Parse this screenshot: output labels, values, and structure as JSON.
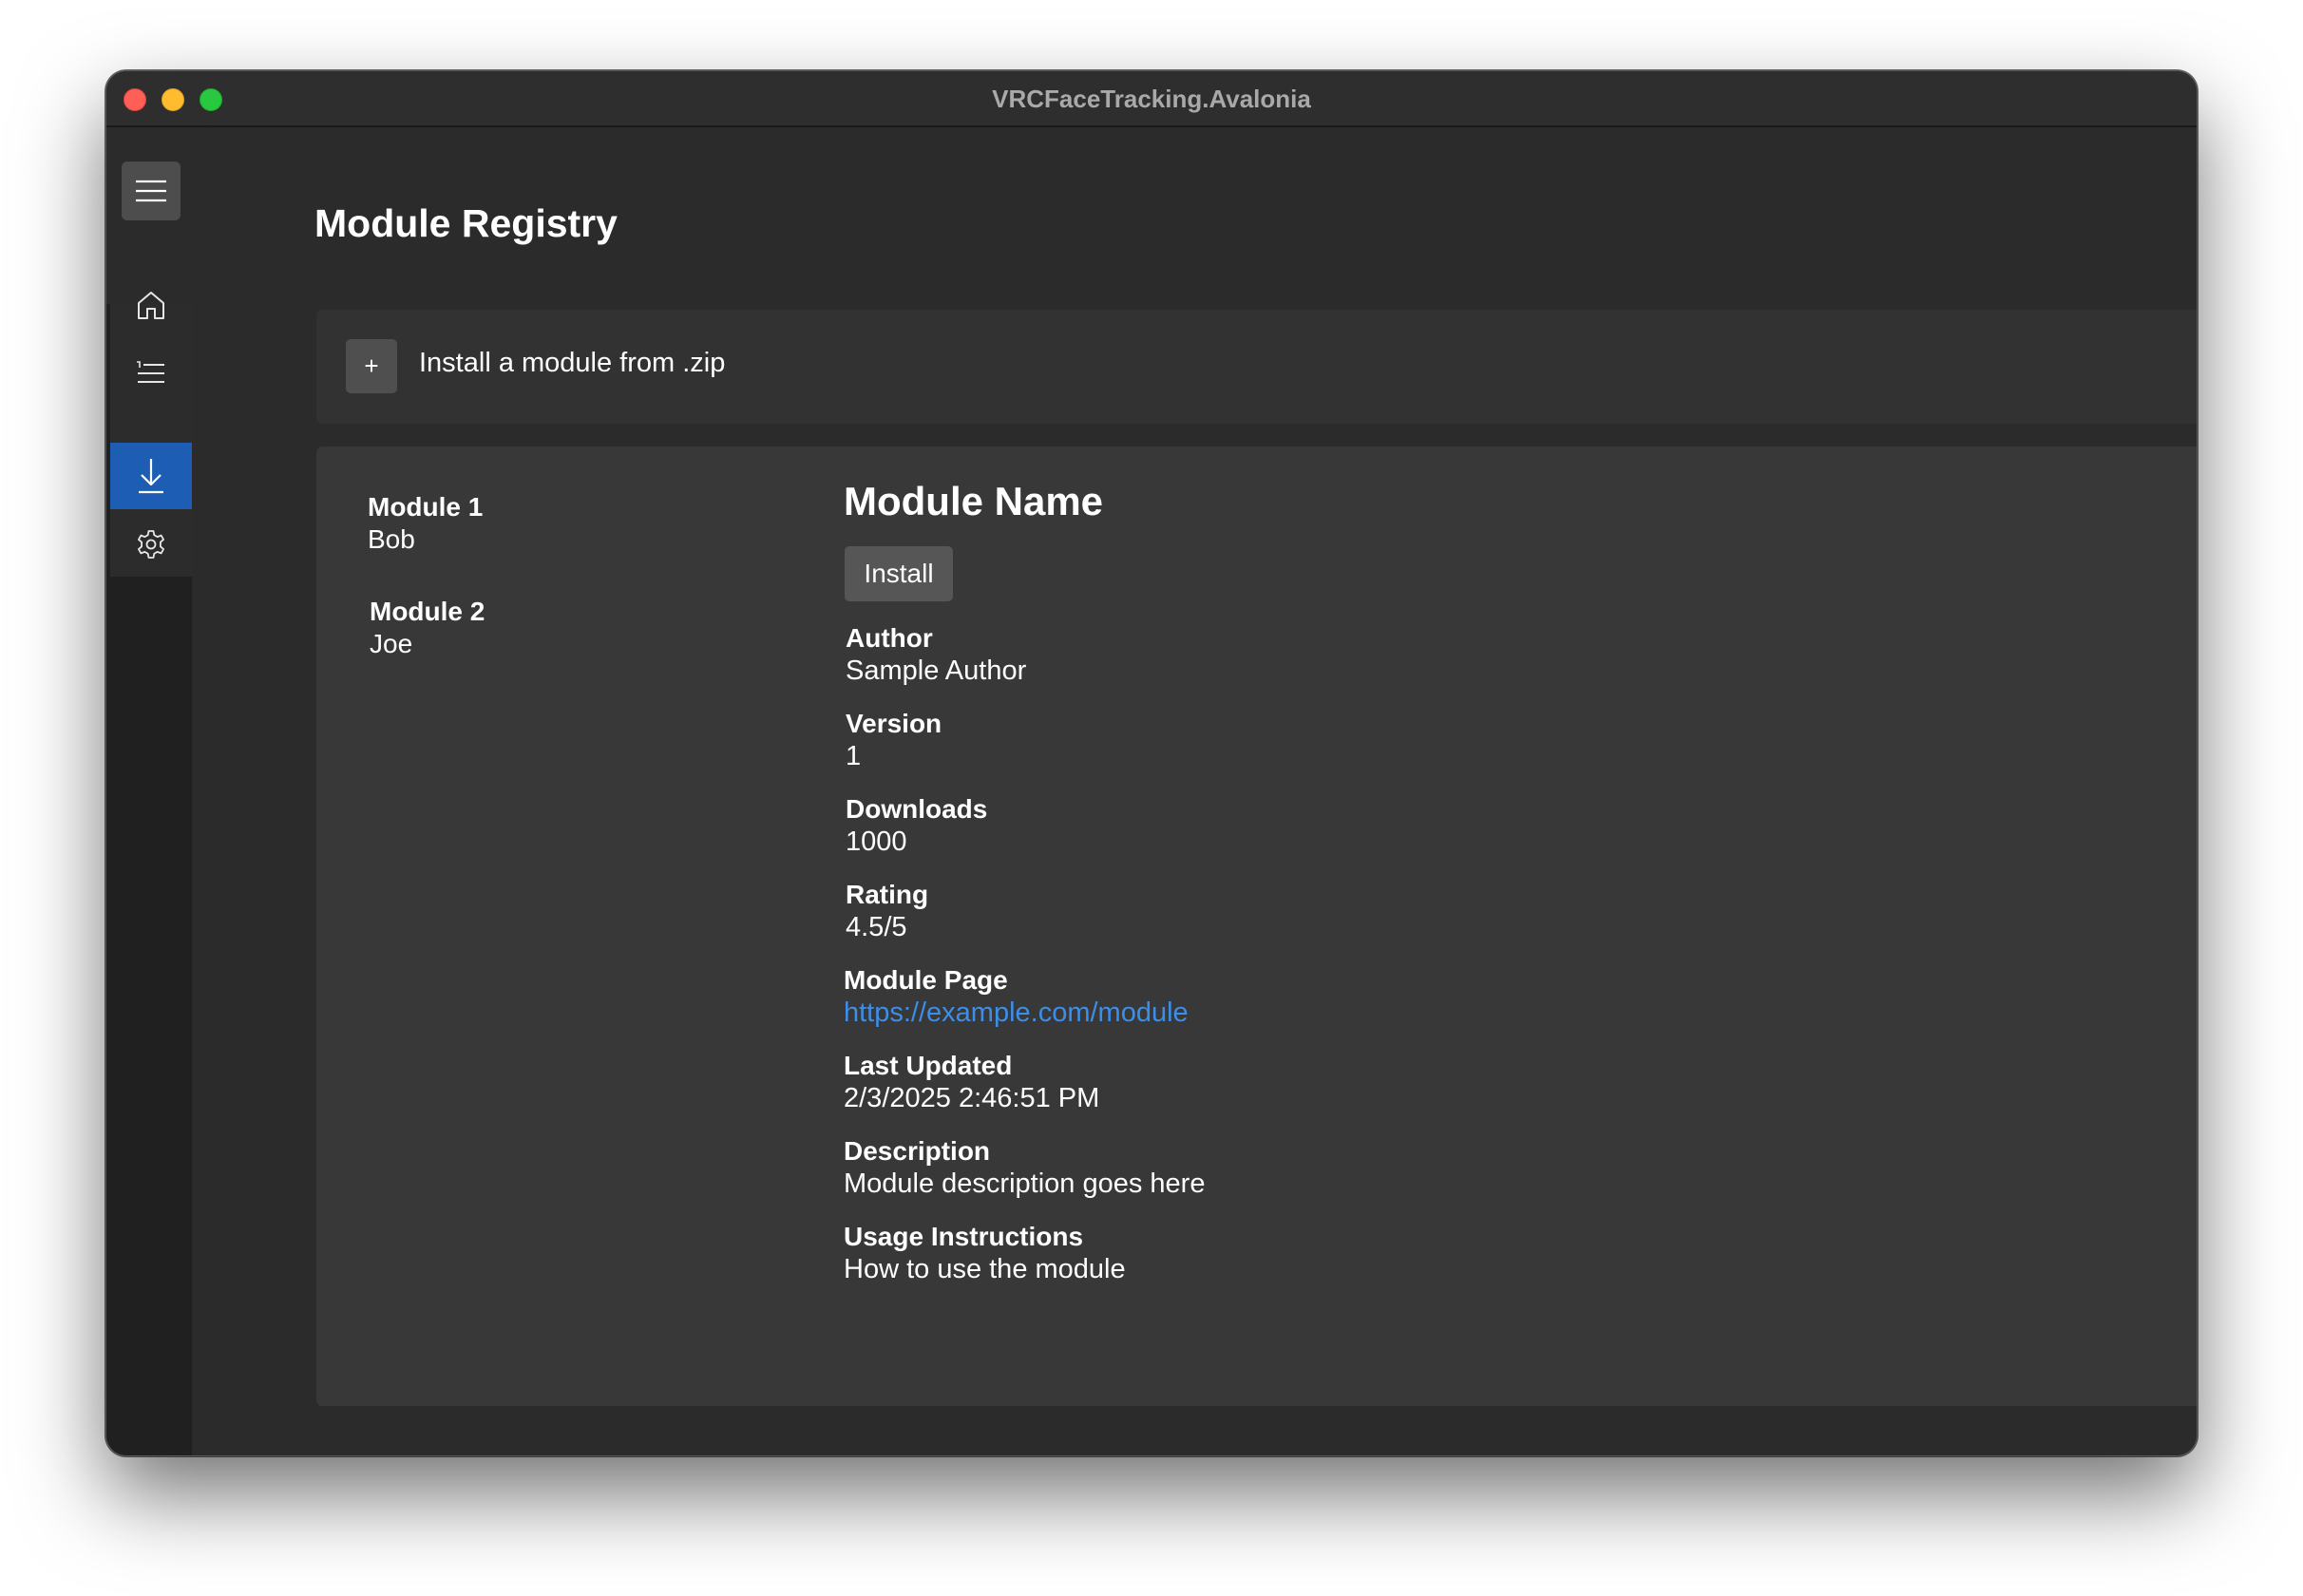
{
  "window": {
    "title": "VRCFaceTracking.Avalonia"
  },
  "sidebar": {
    "menu_icon": "hamburger-icon",
    "items": [
      {
        "name": "home",
        "icon": "home-icon",
        "active": false
      },
      {
        "name": "modules-list",
        "icon": "list-icon",
        "active": false
      },
      {
        "name": "module-registry",
        "icon": "download-icon",
        "active": true
      },
      {
        "name": "settings",
        "icon": "gear-icon",
        "active": false
      }
    ]
  },
  "page": {
    "title": "Module Registry",
    "install_zip": {
      "icon": "+",
      "label": "Install a module from .zip"
    }
  },
  "modules": [
    {
      "name": "Module 1",
      "author": "Bob"
    },
    {
      "name": "Module 2",
      "author": "Joe"
    }
  ],
  "detail": {
    "title": "Module Name",
    "install_label": "Install",
    "author": {
      "label": "Author",
      "value": "Sample Author"
    },
    "version": {
      "label": "Version",
      "value": "1"
    },
    "downloads": {
      "label": "Downloads",
      "value": "1000"
    },
    "rating": {
      "label": "Rating",
      "value": "4.5/5"
    },
    "module_page": {
      "label": "Module Page",
      "value": "https://example.com/module"
    },
    "last_updated": {
      "label": "Last Updated",
      "value": "2/3/2025 2:46:51 PM"
    },
    "description": {
      "label": "Description",
      "value": "Module description goes here"
    },
    "usage": {
      "label": "Usage Instructions",
      "value": "How to use the module"
    }
  },
  "colors": {
    "accent": "#1d5db3",
    "link": "#3c8ee8",
    "background": "#2b2b2b",
    "panel": "#383838"
  }
}
